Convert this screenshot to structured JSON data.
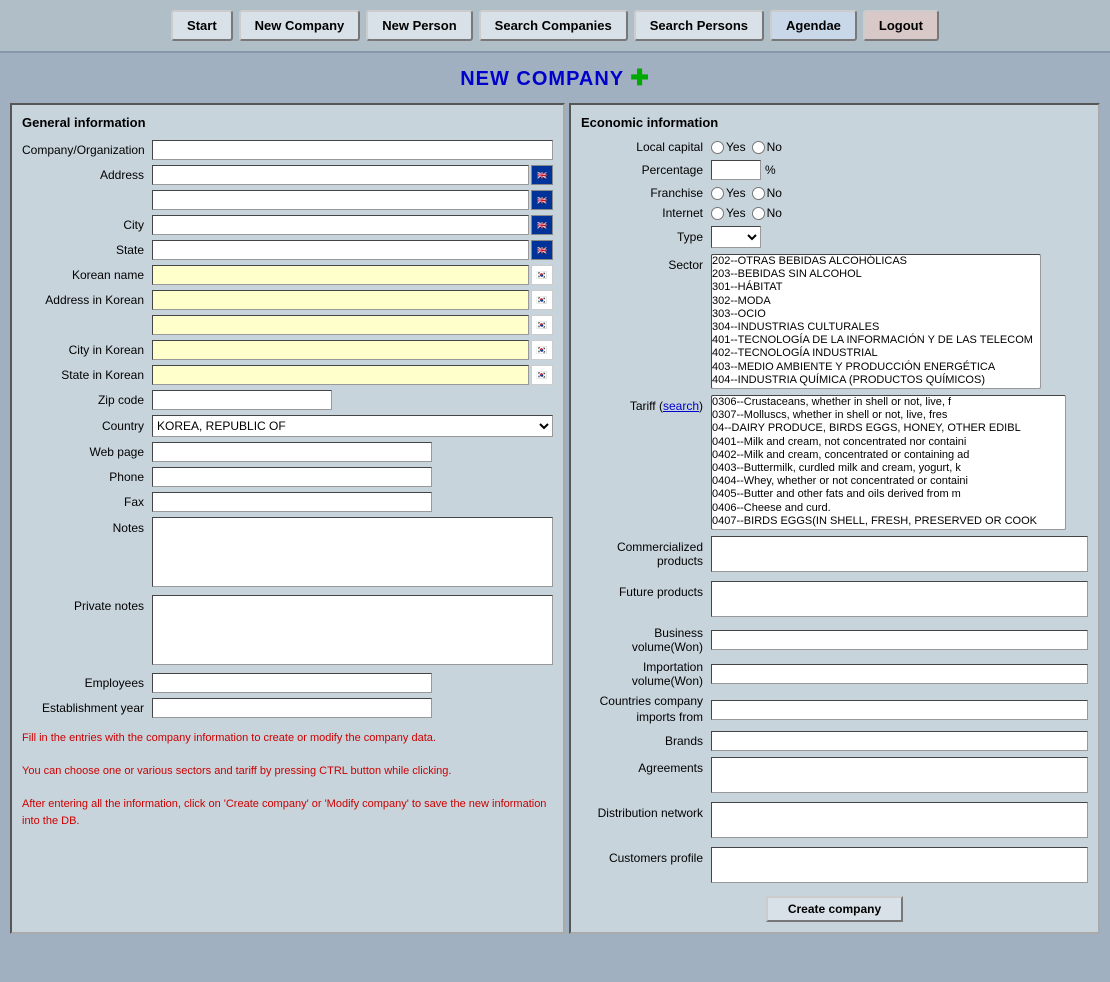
{
  "nav": {
    "start_label": "Start",
    "new_company_label": "New Company",
    "new_person_label": "New Person",
    "search_companies_label": "Search Companies",
    "search_persons_label": "Search Persons",
    "agendae_label": "Agendae",
    "logout_label": "Logout"
  },
  "page_title": "NEW COMPANY",
  "left_section": {
    "title": "General information",
    "fields": {
      "company_label": "Company/Organization",
      "address_label": "Address",
      "city_label": "City",
      "state_label": "State",
      "korean_name_label": "Korean name",
      "address_korean_label": "Address in Korean",
      "city_korean_label": "City in Korean",
      "state_korean_label": "State in Korean",
      "zip_label": "Zip code",
      "country_label": "Country",
      "webpage_label": "Web page",
      "phone_label": "Phone",
      "fax_label": "Fax",
      "notes_label": "Notes",
      "private_notes_label": "Private notes",
      "employees_label": "Employees",
      "establishment_label": "Establishment year"
    },
    "country_default": "KOREA, REPUBLIC OF",
    "instructions": [
      "Fill in the entries with the company information to create or modify the company data.",
      "",
      "You can choose one or various sectors and tariff by pressing CTRL button while clicking.",
      "",
      "After entering all the information, click on 'Create company' or 'Modify company' to save the new information into the DB."
    ]
  },
  "right_section": {
    "title": "Economic information",
    "local_capital_label": "Local capital",
    "percentage_label": "Percentage",
    "franchise_label": "Franchise",
    "internet_label": "Internet",
    "type_label": "Type",
    "sector_label": "Sector",
    "tariff_label": "Tariff",
    "tariff_search": "search",
    "commercialized_label": "Commercialized products",
    "future_label": "Future products",
    "business_volume_label": "Business volume(Won)",
    "importation_volume_label": "Importation volume(Won)",
    "countries_imports_label": "Countries company imports from",
    "brands_label": "Brands",
    "agreements_label": "Agreements",
    "distribution_label": "Distribution network",
    "customers_label": "Customers profile",
    "create_btn": "Create company",
    "sector_options": [
      "202--OTRAS BEBIDAS ALCOHÓLICAS",
      "203--BEBIDAS SIN ALCOHOL",
      "301--HÁBITAT",
      "302--MODA",
      "303--OCIO",
      "304--INDUSTRIAS CULTURALES",
      "401--TECNOLOGÍA DE LA INFORMACIÓN Y DE LAS TELECOM",
      "402--TECNOLOGÍA INDUSTRIAL",
      "403--MEDIO AMBIENTE Y PRODUCCIÓN ENERGÉTICA",
      "404--INDUSTRIA QUÍMICA (PRODUCTOS QUÍMICOS)"
    ],
    "tariff_options": [
      "0306--Crustaceans, whether in shell or not, live, f",
      "0307--Molluscs, whether in shell or not, live, fres",
      "04--DAIRY PRODUCE, BIRDS EGGS, HONEY, OTHER EDIBL",
      "0401--Milk and cream, not concentrated nor containi",
      "0402--Milk and cream, concentrated or containing ad",
      "0403--Buttermilk, curdled milk and cream, yogurt, k",
      "0404--Whey, whether or not concentrated or containi",
      "0405--Butter and other fats and oils derived from m",
      "0406--Cheese and curd.",
      "0407--BIRDS EGGS(IN SHELL, FRESH, PRESERVED OR COOK"
    ]
  }
}
